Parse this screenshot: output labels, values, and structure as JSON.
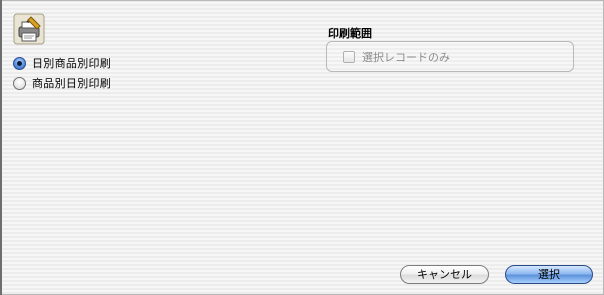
{
  "app_icon": "printer-icon",
  "print_mode": {
    "options": [
      {
        "label": "日別商品別印刷",
        "checked": true
      },
      {
        "label": "商品別日別印刷",
        "checked": false
      }
    ]
  },
  "print_range": {
    "title": "印刷範囲",
    "selected_only_label": "選択レコードのみ",
    "selected_only_checked": false,
    "selected_only_enabled": false
  },
  "buttons": {
    "cancel_label": "キャンセル",
    "select_label": "選択"
  },
  "colors": {
    "accent": "#5d93dc",
    "disabled_text": "#8c8c8c"
  }
}
